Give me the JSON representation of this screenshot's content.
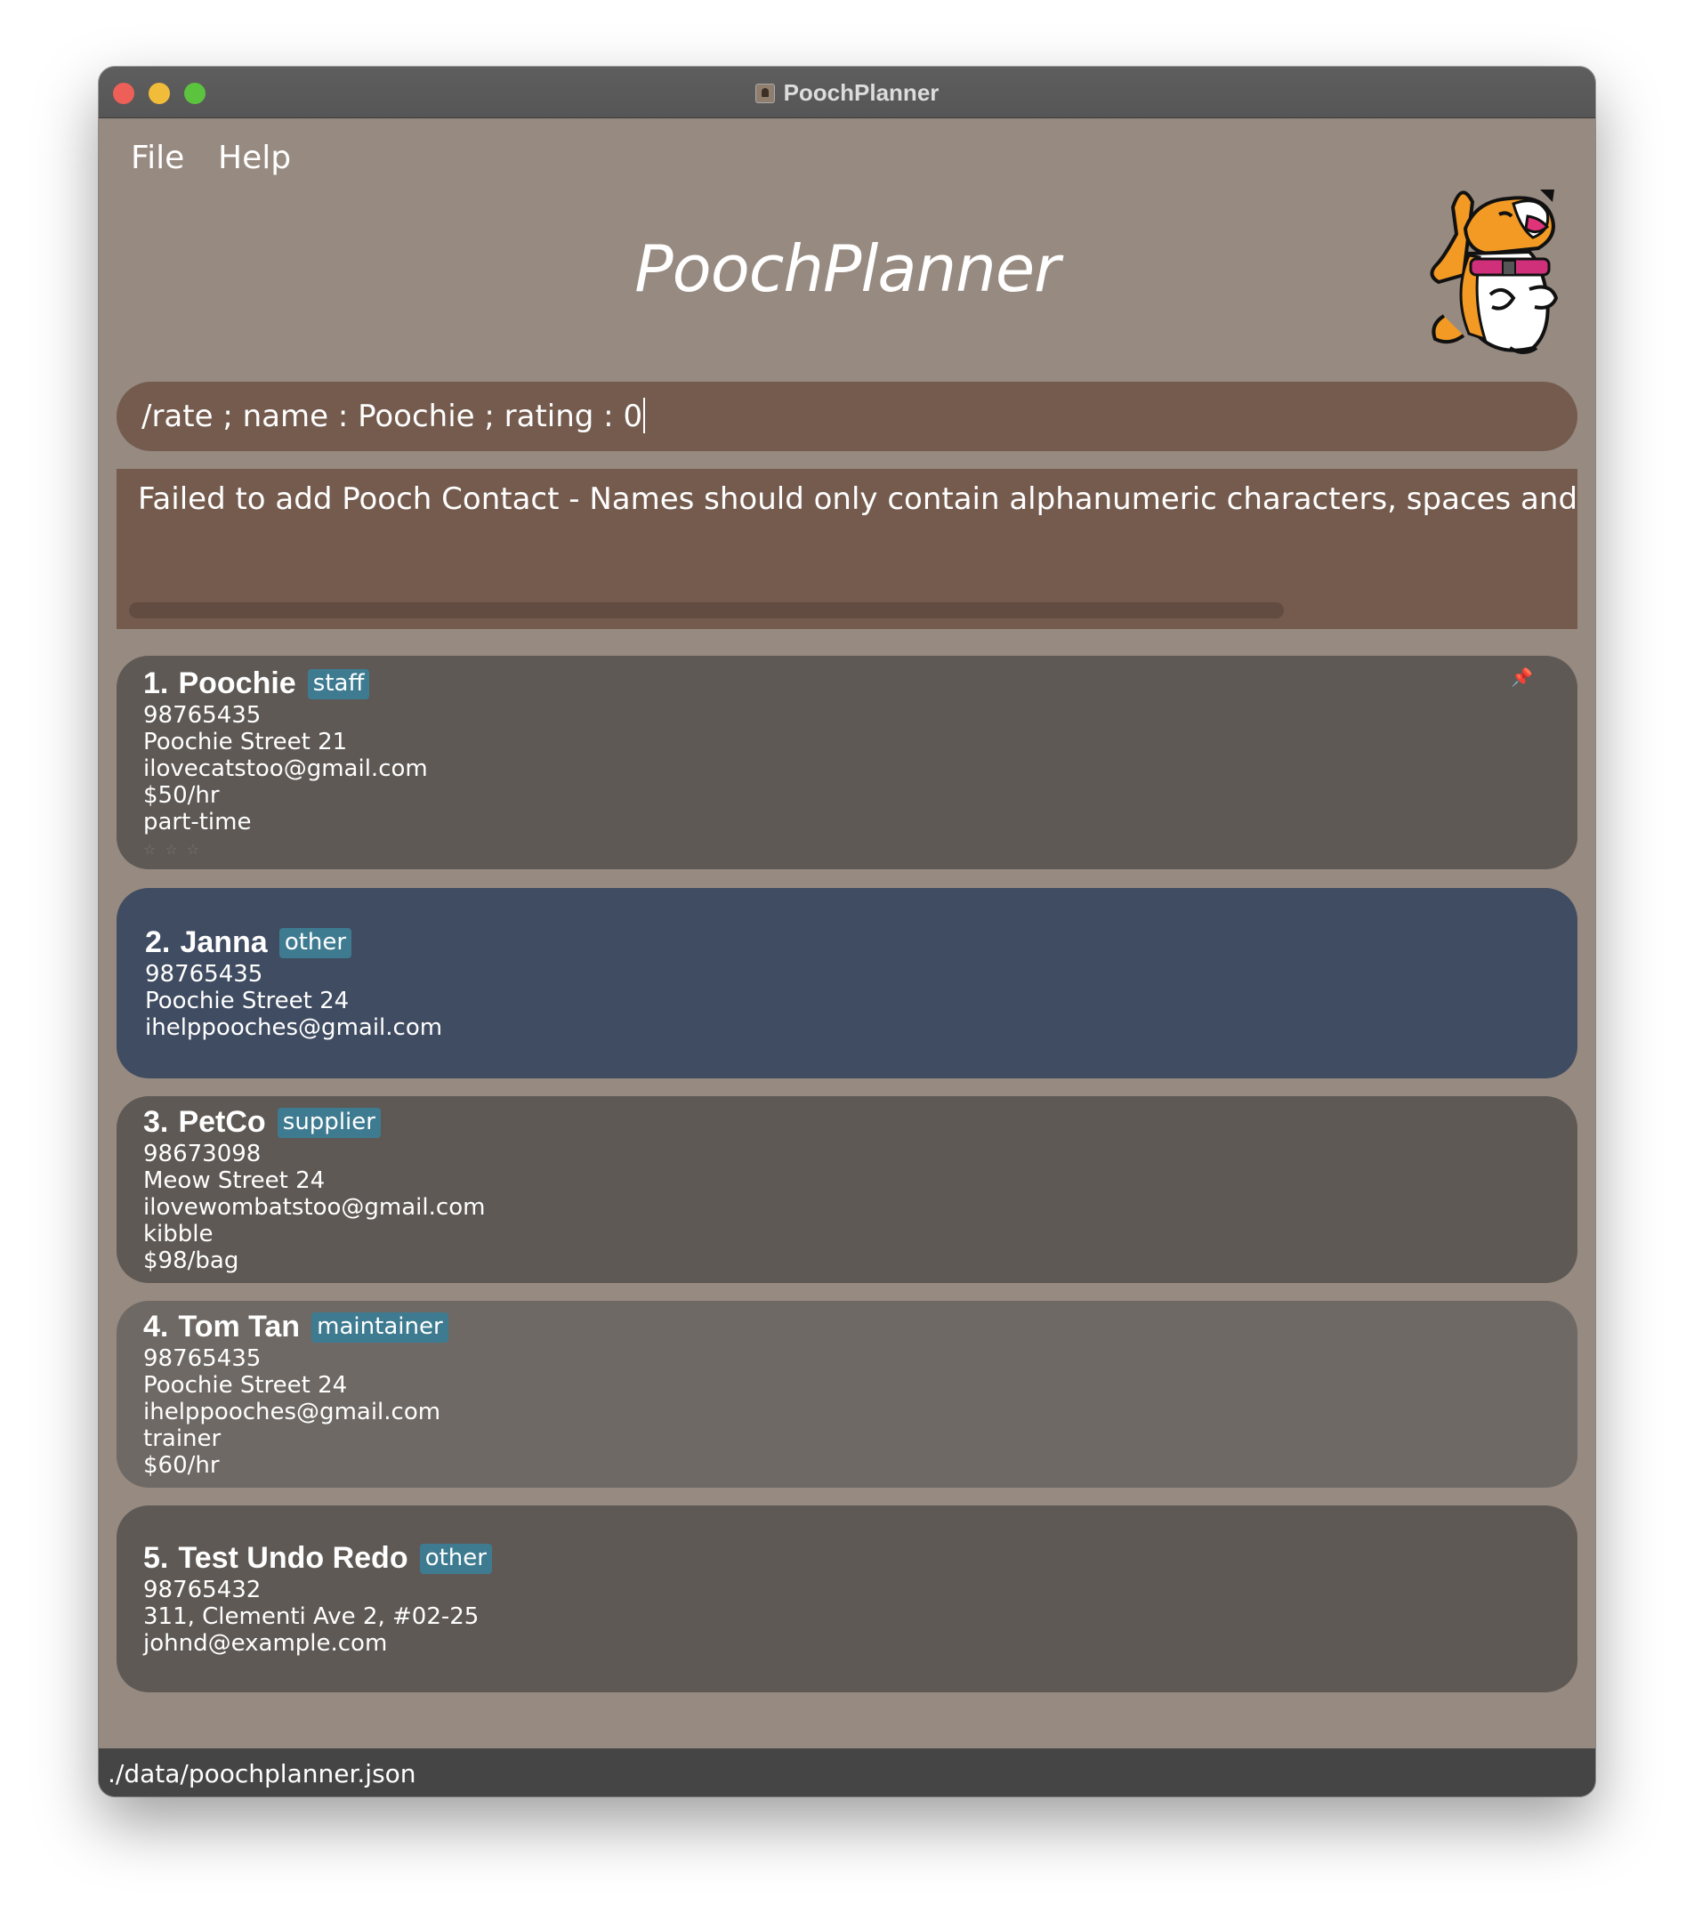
{
  "window": {
    "title": "PoochPlanner"
  },
  "menu": {
    "file_label": "File",
    "help_label": "Help"
  },
  "header": {
    "app_title": "PoochPlanner"
  },
  "command_box": {
    "value": "/rate ; name : Poochie ; rating : 0"
  },
  "result_display": {
    "text": "Failed to add Pooch Contact - Names should only contain alphanumeric characters, spaces and '/', and i"
  },
  "contacts": [
    {
      "index": "1.",
      "name": "Poochie",
      "tag": "staff",
      "lines": [
        "98765435",
        "Poochie Street 21",
        "ilovecatstoo@gmail.com",
        "$50/hr",
        "part-time"
      ],
      "rating": 0,
      "pinned": true
    },
    {
      "index": "2.",
      "name": "Janna",
      "tag": "other",
      "lines": [
        "98765435",
        "Poochie Street 24",
        "ihelppooches@gmail.com"
      ],
      "selected": true
    },
    {
      "index": "3.",
      "name": "PetCo",
      "tag": "supplier",
      "lines": [
        "98673098",
        "Meow Street 24",
        "ilovewombatstoo@gmail.com",
        "kibble",
        "$98/bag"
      ]
    },
    {
      "index": "4.",
      "name": "Tom Tan",
      "tag": "maintainer",
      "lines": [
        "98765435",
        "Poochie Street 24",
        "ihelppooches@gmail.com",
        "trainer",
        "$60/hr"
      ]
    },
    {
      "index": "5.",
      "name": "Test Undo Redo",
      "tag": "other",
      "lines": [
        "98765432",
        "311, Clementi Ave 2, #02-25",
        "johnd@example.com"
      ]
    }
  ],
  "status_bar": {
    "path": "./data/poochplanner.json"
  },
  "colors": {
    "window_bg": "#978a80",
    "command_bg": "#745b4e",
    "card_bg": "#5e5955",
    "card_selected_bg": "#404c61",
    "tag_bg": "#3e7b91",
    "status_bg": "#454545"
  },
  "icons": {
    "pin": "pin-icon",
    "star": "star-icon",
    "mascot": "dog-mascot-icon"
  }
}
